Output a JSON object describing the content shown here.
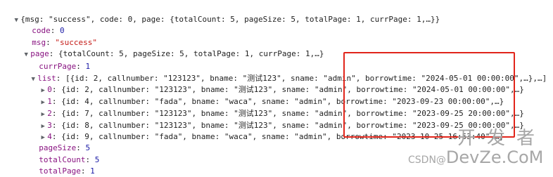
{
  "root": {
    "summary": "{msg: \"success\", code: 0, page: {totalCount: 5, pageSize: 5, totalPage: 1, currPage: 1,…}}"
  },
  "code": {
    "key": "code",
    "value": "0"
  },
  "msg": {
    "key": "msg",
    "value": "\"success\""
  },
  "page": {
    "key": "page",
    "summary": "{totalCount: 5, pageSize: 5, totalPage: 1, currPage: 1,…}",
    "currPage": {
      "key": "currPage",
      "value": "1"
    },
    "list": {
      "key": "list",
      "summary": "[{id: 2, callnumber: \"123123\", bname: \"测试123\", sname: \"admin\", borrowtime: \"2024-05-01 00:00:00\",…},…]",
      "items": [
        {
          "index": "0",
          "text": "{id: 2, callnumber: \"123123\", bname: \"测试123\", sname: \"admin\", borrowtime: \"2024-05-01 00:00:00\",…}"
        },
        {
          "index": "1",
          "text": "{id: 4, callnumber: \"fada\", bname: \"waca\", sname: \"admin\", borrowtime: \"2023-09-23 00:00:00\",…}"
        },
        {
          "index": "2",
          "text": "{id: 7, callnumber: \"123123\", bname: \"测试123\", sname: \"admin\", borrowtime: \"2023-09-25 20:00:00\",…}"
        },
        {
          "index": "3",
          "text": "{id: 8, callnumber: \"123123\", bname: \"测试123\", sname: \"admin\", borrowtime: \"2023-09-25 00:00:00\",…}"
        },
        {
          "index": "4",
          "text": "{id: 9, callnumber: \"fada\", bname: \"waca\", sname: \"admin\", borrowtime: \"2023-10-25 16:53:40\",…}"
        }
      ]
    },
    "pageSize": {
      "key": "pageSize",
      "value": "5"
    },
    "totalCount": {
      "key": "totalCount",
      "value": "5"
    },
    "totalPage": {
      "key": "totalPage",
      "value": "1"
    }
  },
  "watermark": {
    "top": "开发者",
    "bottom_prefix": "CSDN@",
    "bottom_brand": "DevZe.CoM"
  },
  "colors": {
    "key": "#881280",
    "string": "#c41a16",
    "number": "#1a1aa6",
    "highlight": "#e1251b"
  }
}
